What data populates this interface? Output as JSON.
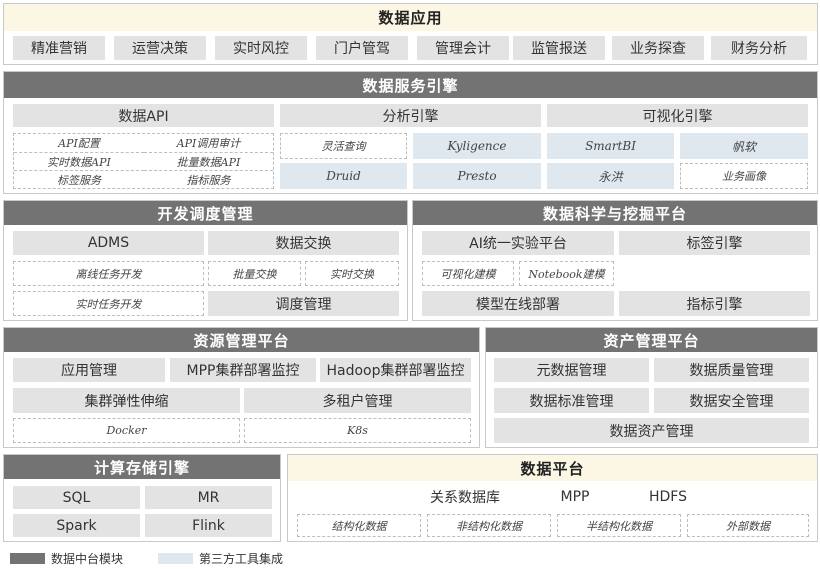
{
  "data_app": {
    "title": "数据应用",
    "items": [
      "精准营销",
      "运营决策",
      "实时风控",
      "门户管驾",
      "管理会计",
      "监管报送",
      "业务探查",
      "财务分析"
    ]
  },
  "data_service": {
    "title": "数据服务引擎",
    "groups": [
      "数据API",
      "分析引擎",
      "可视化引擎"
    ],
    "api_items": [
      "API配置",
      "API调用审计",
      "实时数据API",
      "批量数据API",
      "标签服务",
      "指标服务"
    ],
    "analysis_items": [
      "灵活查询",
      "Kyligence",
      "Druid",
      "Presto"
    ],
    "viz_items": [
      "SmartBI",
      "帆软",
      "永洪",
      "业务画像"
    ]
  },
  "dev_sched": {
    "title": "开发调度管理",
    "adms": "ADMS",
    "exchange": "数据交换",
    "offline_dev": "离线任务开发",
    "batch_exchange": "批量交换",
    "realtime_exchange": "实时交换",
    "realtime_dev": "实时任务开发",
    "scheduling": "调度管理"
  },
  "data_science": {
    "title": "数据科学与挖掘平台",
    "ai_lab": "AI统一实验平台",
    "tag_engine": "标签引擎",
    "viz_modeling": "可视化建模",
    "notebook": "Notebook建模",
    "model_deploy": "模型在线部署",
    "metric_engine": "指标引擎"
  },
  "resource_mgmt": {
    "title": "资源管理平台",
    "app_mgmt": "应用管理",
    "mpp_monitor": "MPP集群部署监控",
    "hadoop_monitor": "Hadoop集群部署监控",
    "elastic": "集群弹性伸缩",
    "multi_tenant": "多租户管理",
    "docker": "Docker",
    "k8s": "K8s"
  },
  "asset_mgmt": {
    "title": "资产管理平台",
    "metadata": "元数据管理",
    "quality": "数据质量管理",
    "standard": "数据标准管理",
    "security": "数据安全管理",
    "asset": "数据资产管理"
  },
  "compute": {
    "title": "计算存储引擎",
    "items": [
      "SQL",
      "MR",
      "Spark",
      "Flink"
    ]
  },
  "data_platform": {
    "title": "数据平台",
    "stores": [
      "关系数据库",
      "MPP",
      "HDFS"
    ],
    "data_types": [
      "结构化数据",
      "非结构化数据",
      "半结构化数据",
      "外部数据"
    ]
  },
  "legend": {
    "module_label": "数据中台模块",
    "module_color": "#737373",
    "third_party_label": "第三方工具集成",
    "third_party_color": "#dfe8ef"
  }
}
